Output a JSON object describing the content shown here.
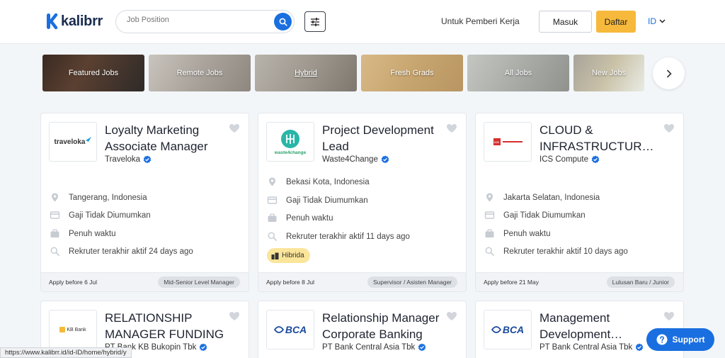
{
  "header": {
    "logo_text": "kalibrr",
    "search_placeholder": "Job Position",
    "employer_link": "Untuk Pemberi Kerja",
    "login_label": "Masuk",
    "register_label": "Daftar",
    "language": "ID"
  },
  "categories": [
    {
      "label": "Featured Jobs"
    },
    {
      "label": "Remote Jobs"
    },
    {
      "label": "Hybrid"
    },
    {
      "label": "Fresh Grads"
    },
    {
      "label": "All Jobs"
    },
    {
      "label": "New Jobs"
    }
  ],
  "jobs": [
    {
      "title": "Loyalty Marketing Associate Manager",
      "company": "Traveloka",
      "logo_text": "traveloka",
      "location": "Tangerang, Indonesia",
      "salary": "Gaji Tidak Diumumkan",
      "type": "Penuh waktu",
      "activity": "Rekruter terakhir aktif 24 days ago",
      "apply": "Apply before 6 Jul",
      "level": "Mid-Senior Level Manager"
    },
    {
      "title": "Project Development Lead",
      "company": "Waste4Change",
      "logo_text": "waste4change",
      "location": "Bekasi Kota, Indonesia",
      "salary": "Gaji Tidak Diumumkan",
      "type": "Penuh waktu",
      "activity": "Rekruter terakhir aktif 11 days ago",
      "badge": "Hibrida",
      "apply": "Apply before 8 Jul",
      "level": "Supervisor / Asisten Manager"
    },
    {
      "title": "CLOUD & INFRASTRUCTURE ENGINEER",
      "company": "ICS Compute",
      "logo_text": "ICS",
      "location": "Jakarta Selatan, Indonesia",
      "salary": "Gaji Tidak Diumumkan",
      "type": "Penuh waktu",
      "activity": "Rekruter terakhir aktif 10 days ago",
      "apply": "Apply before 21 May",
      "level": "Lulusan Baru / Junior"
    },
    {
      "title": "RELATIONSHIP MANAGER FUNDING",
      "company": "PT Bank KB Bukopin Tbk",
      "logo_text": "KB Bank"
    },
    {
      "title": "Relationship Manager Corporate Banking",
      "company": "PT Bank Central Asia Tbk",
      "logo_text": "BCA"
    },
    {
      "title": "Management Development Program",
      "company": "PT Bank Central Asia Tbk",
      "logo_text": "BCA"
    }
  ],
  "status_url": "https://www.kalibrr.id/id-ID/home/hybrid/y",
  "support_label": "Support",
  "colors": {
    "brand": "#1a6fe0",
    "accent": "#f6b93b",
    "badge": "#fbe59a"
  }
}
